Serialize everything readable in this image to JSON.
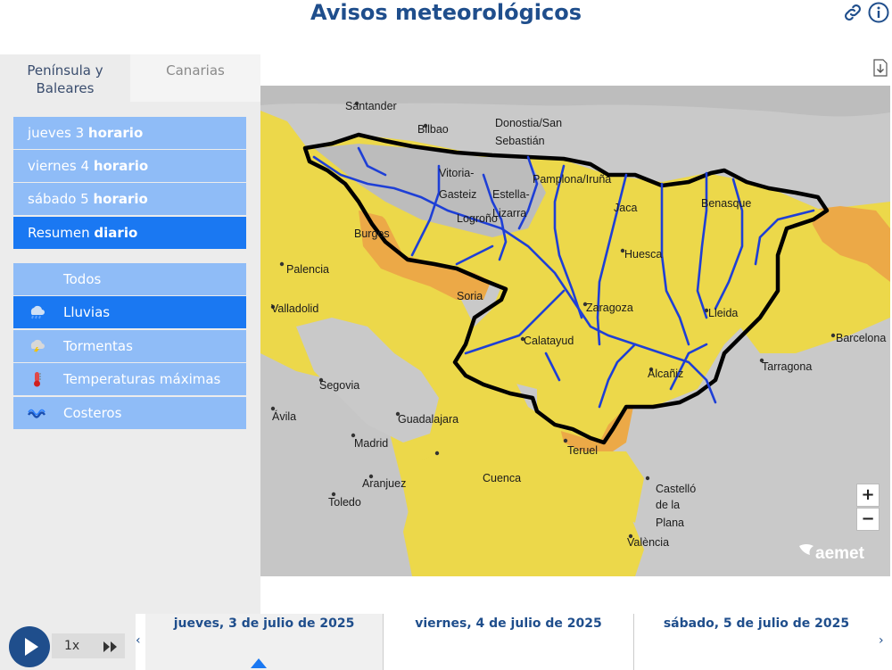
{
  "header": {
    "title": "Avisos meteorológicos"
  },
  "tabs": [
    {
      "label": "Península y Baleares"
    },
    {
      "label": "Canarias"
    }
  ],
  "days": [
    {
      "prefix": "jueves 3 ",
      "bold": "horario"
    },
    {
      "prefix": "viernes 4 ",
      "bold": "horario"
    },
    {
      "prefix": "sábado 5 ",
      "bold": "horario"
    },
    {
      "prefix": "Resumen ",
      "bold": "diario"
    }
  ],
  "phenomena": [
    {
      "label": "Todos",
      "icon": "none"
    },
    {
      "label": "Lluvias",
      "icon": "rain-icon"
    },
    {
      "label": "Tormentas",
      "icon": "storm-icon"
    },
    {
      "label": "Temperaturas máximas",
      "icon": "thermometer-icon"
    },
    {
      "label": "Costeros",
      "icon": "waves-icon"
    }
  ],
  "map": {
    "cities": [
      "Santander",
      "Bilbao",
      "Donostia/San",
      "Sebastián",
      "Vitoria-",
      "Gasteiz",
      "Estella-",
      "Lizarra",
      "Pamplona/Iruña",
      "Logroño",
      "Burgos",
      "Jaca",
      "Benasque",
      "Palencia",
      "Huesca",
      "Soria",
      "Valladolid",
      "Zaragoza",
      "Lleida",
      "Calatayud",
      "Barcelona",
      "Alcañiz",
      "Tarragona",
      "Segovia",
      "Ávila",
      "Guadalajara",
      "Madrid",
      "Teruel",
      "Aranjuez",
      "Cuenca",
      "Toledo",
      "Castelló",
      "de la",
      "Plana",
      "València"
    ],
    "logo": "aemet",
    "colors": {
      "yellow": "#ecd84a",
      "orange": "#eca947",
      "gray": "#c8c8c8",
      "border": "#000000",
      "rivers": "#1e3fd6"
    }
  },
  "zoom": {
    "in": "+",
    "out": "−"
  },
  "timeline": {
    "speed": "1x",
    "dates": [
      "jueves, 3 de julio de 2025",
      "viernes, 4 de julio de 2025",
      "sábado, 5 de julio de 2025"
    ]
  }
}
